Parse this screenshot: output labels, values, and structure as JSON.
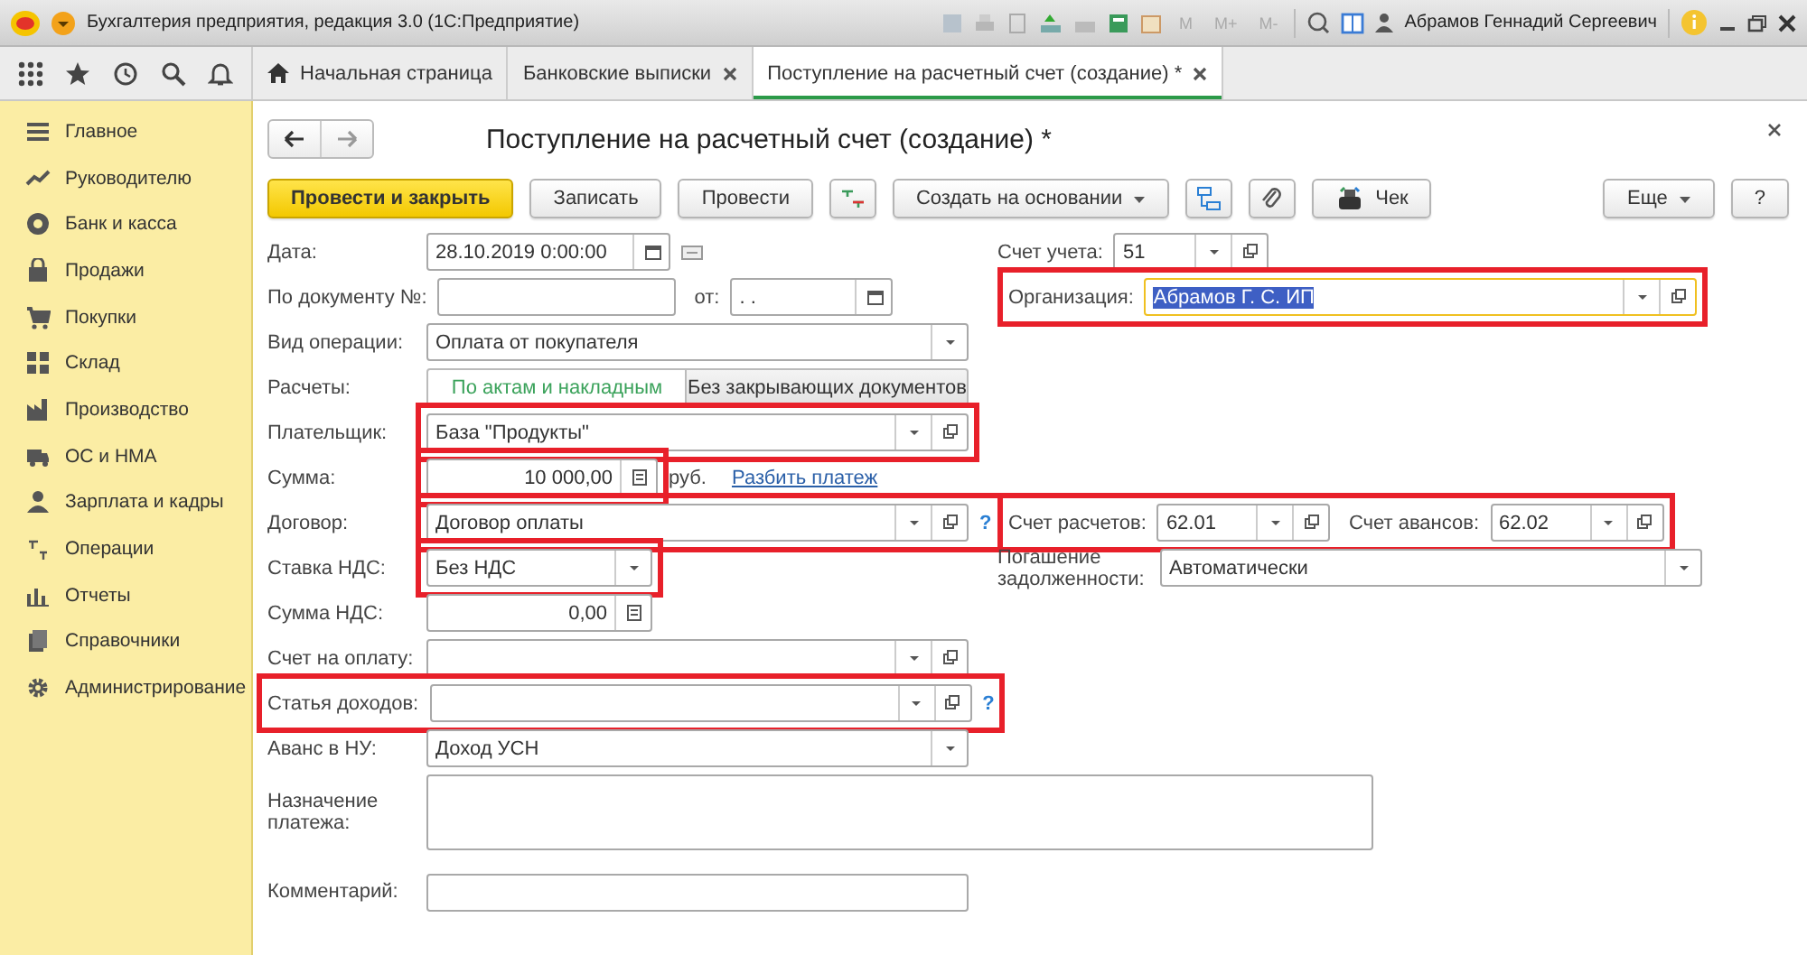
{
  "app": {
    "title": "Бухгалтерия предприятия, редакция 3.0  (1С:Предприятие)",
    "memory_keys": [
      "M",
      "M+",
      "M-"
    ],
    "user": "Абрамов Геннадий Сергеевич"
  },
  "tabs": [
    {
      "label": "Начальная страница",
      "kind": "home",
      "selected": false
    },
    {
      "label": "Банковские выписки",
      "kind": "closable",
      "selected": false
    },
    {
      "label": "Поступление на расчетный счет (создание) *",
      "kind": "closable",
      "selected": true
    }
  ],
  "sidebar": {
    "items": [
      {
        "label": "Главное",
        "kind": "menu"
      },
      {
        "label": "Руководителю",
        "kind": "trend"
      },
      {
        "label": "Банк и касса",
        "kind": "coin"
      },
      {
        "label": "Продажи",
        "kind": "bag"
      },
      {
        "label": "Покупки",
        "kind": "cart"
      },
      {
        "label": "Склад",
        "kind": "grid"
      },
      {
        "label": "Производство",
        "kind": "factory"
      },
      {
        "label": "ОС и НМА",
        "kind": "truck"
      },
      {
        "label": "Зарплата и кадры",
        "kind": "person"
      },
      {
        "label": "Операции",
        "kind": "dtkt"
      },
      {
        "label": "Отчеты",
        "kind": "bars"
      },
      {
        "label": "Справочники",
        "kind": "books"
      },
      {
        "label": "Администрирование",
        "kind": "gear"
      }
    ]
  },
  "form": {
    "title": "Поступление на расчетный счет (создание) *",
    "commands": [
      {
        "kind": "primary",
        "label": "Провести и закрыть"
      },
      {
        "kind": "plain",
        "label": "Записать"
      },
      {
        "kind": "plain",
        "label": "Провести"
      },
      {
        "kind": "dtkt"
      },
      {
        "kind": "menu",
        "label": "Создать на основании"
      },
      {
        "kind": "structure"
      },
      {
        "kind": "attach"
      },
      {
        "kind": "receipt",
        "label": "Чек"
      }
    ],
    "more": "Еще",
    "help": "?",
    "rows": [
      {
        "left": {
          "items": [
            {
              "label": "Дата:",
              "kind": "datetime",
              "value": "28.10.2019  0:00:00"
            },
            {
              "kind": "note"
            }
          ]
        },
        "right": {
          "items": [
            {
              "label": "Счет учета:",
              "kind": "ref",
              "value": "51"
            }
          ]
        }
      },
      {
        "left": {
          "items": [
            {
              "label": "По документу №:",
              "kind": "text"
            },
            {
              "label": "от:",
              "kind": "date",
              "value": ".  ."
            }
          ]
        },
        "right": {
          "highlighted": true,
          "items": [
            {
              "label": "Организация:",
              "kind": "ref",
              "value": "Абрамов Г. С. ИП",
              "focused": true
            }
          ]
        }
      },
      {
        "left": {
          "items": [
            {
              "label": "Вид операции:",
              "kind": "choice",
              "value": "Оплата от покупателя"
            }
          ]
        }
      },
      {
        "left": {
          "items": [
            {
              "label": "Расчеты:",
              "kind": "toggle",
              "options": [
                {
                  "label": "По актам и накладным",
                  "selected": true
                },
                {
                  "label": "Без закрывающих документов",
                  "selected": false
                }
              ]
            }
          ]
        }
      },
      {
        "left": {
          "items": [
            {
              "label": "Плательщик:",
              "kind": "ref",
              "value": "База \"Продукты\"",
              "highlighted": true
            }
          ]
        }
      },
      {
        "left": {
          "items": [
            {
              "label": "Сумма:",
              "kind": "amount",
              "value": "10 000,00",
              "highlighted": true,
              "suffix": "руб.",
              "link": "Разбить платеж"
            }
          ]
        }
      },
      {
        "left": {
          "items": [
            {
              "label": "Договор:",
              "kind": "ref",
              "value": "Договор оплаты",
              "highlighted": true,
              "help": "?"
            }
          ]
        },
        "right": {
          "highlighted": true,
          "items": [
            {
              "label": "Счет расчетов:",
              "kind": "ref",
              "value": "62.01"
            },
            {
              "label": "Счет авансов:",
              "kind": "ref",
              "value": "62.02"
            }
          ]
        }
      },
      {
        "left": {
          "items": [
            {
              "label": "Ставка НДС:",
              "kind": "choice",
              "value": "Без НДС",
              "highlighted": true
            }
          ]
        },
        "right": {
          "items": [
            {
              "label": "Погашение задолженности:",
              "kind": "choice",
              "value": "Автоматически"
            }
          ]
        }
      },
      {
        "left": {
          "items": [
            {
              "label": "Сумма НДС:",
              "kind": "amount",
              "value": "0,00"
            }
          ]
        }
      },
      {
        "left": {
          "items": [
            {
              "label": "Счет на оплату:",
              "kind": "ref"
            }
          ]
        }
      },
      {
        "left": {
          "highlighted": true,
          "items": [
            {
              "label": "Статья доходов:",
              "kind": "ref",
              "help": "?"
            }
          ]
        }
      },
      {
        "left": {
          "items": [
            {
              "label": "Аванс в НУ:",
              "kind": "choice",
              "value": "Доход УСН"
            }
          ]
        }
      },
      {
        "left": {
          "items": [
            {
              "label": "Назначение платежа:",
              "kind": "memo"
            }
          ]
        }
      },
      {
        "left": {
          "items": [
            {
              "label": "Комментарий:",
              "kind": "text"
            }
          ]
        }
      }
    ]
  }
}
